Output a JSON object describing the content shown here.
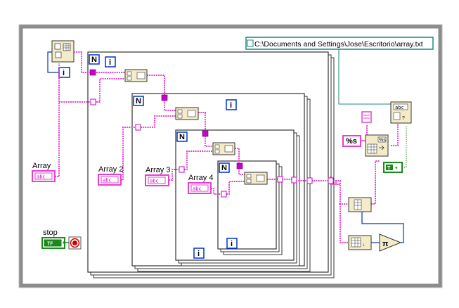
{
  "file_path": "C:\\Documents and Settings\\Jose\\Escritorio\\array.txt",
  "controls": {
    "array_1": {
      "label": "Array",
      "type": "abc"
    },
    "array_2": {
      "label": "Array 2",
      "type": "abc"
    },
    "array_3": {
      "label": "Array 3",
      "type": "abc"
    },
    "array_4": {
      "label": "Array 4",
      "type": "abc"
    },
    "stop": {
      "label": "stop",
      "type": "TF"
    }
  },
  "loops": {
    "count_terminal": "N",
    "iteration_terminal": "i"
  },
  "format_string": "%s",
  "boolean_constant": "T"
}
